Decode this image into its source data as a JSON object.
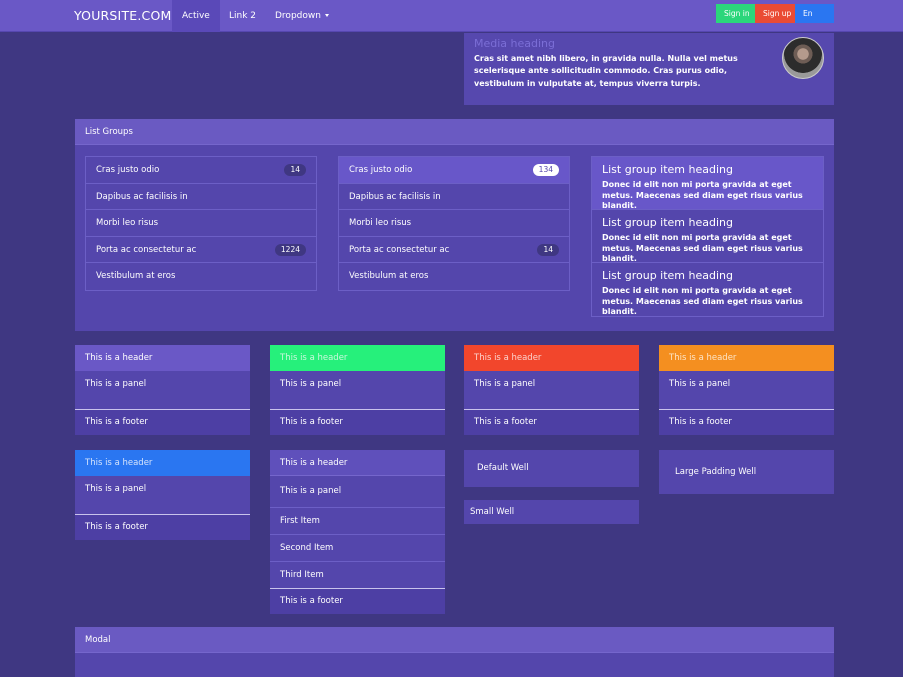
{
  "navbar": {
    "brand": "YOURSITE.COM",
    "links": [
      "Active",
      "Link 2",
      "Dropdown"
    ],
    "buttons": [
      {
        "label": "Sign in",
        "color": "#2bd67b"
      },
      {
        "label": "Sign up",
        "color": "#ea4b34"
      },
      {
        "label": "En",
        "color": "#2a76f1"
      }
    ],
    "background": "#6a58c6"
  },
  "media": {
    "heading": "Media heading",
    "text": "Cras sit amet nibh libero, in gravida nulla. Nulla vel metus scelerisque ante sollicitudin commodo. Cras purus odio, vestibulum in vulputate at, tempus viverra turpis.",
    "avatar_icon": "user-photo"
  },
  "list_groups": {
    "title": "List Groups",
    "list1": [
      {
        "label": "Cras justo odio",
        "badge": "14"
      },
      {
        "label": "Dapibus ac facilisis in",
        "badge": ""
      },
      {
        "label": "Morbi leo risus",
        "badge": ""
      },
      {
        "label": "Porta ac consectetur ac",
        "badge": "1224"
      },
      {
        "label": "Vestibulum at eros",
        "badge": ""
      }
    ],
    "list2": [
      {
        "label": "Cras justo odio",
        "badge": "134"
      },
      {
        "label": "Dapibus ac facilisis in",
        "badge": ""
      },
      {
        "label": "Morbi leo risus",
        "badge": ""
      },
      {
        "label": "Porta ac consectetur ac",
        "badge": "14"
      },
      {
        "label": "Vestibulum at eros",
        "badge": ""
      }
    ],
    "list3": [
      {
        "heading": "List group item heading",
        "text": "Donec id elit non mi porta gravida at eget metus. Maecenas sed diam eget risus varius blandit."
      },
      {
        "heading": "List group item heading",
        "text": "Donec id elit non mi porta gravida at eget metus. Maecenas sed diam eget risus varius blandit."
      },
      {
        "heading": "List group item heading",
        "text": "Donec id elit non mi porta gravida at eget metus. Maecenas sed diam eget risus varius blandit."
      }
    ]
  },
  "panels": [
    {
      "header": "This is a header",
      "body": "This is a panel",
      "footer": "This is a footer",
      "color": "#6a58c6"
    },
    {
      "header": "This is a header",
      "body": "This is a panel",
      "footer": "This is a footer",
      "color": "#26f07b"
    },
    {
      "header": "This is a header",
      "body": "This is a panel",
      "footer": "This is a footer",
      "color": "#f2462c"
    },
    {
      "header": "This is a header",
      "body": "This is a panel",
      "footer": "This is a footer",
      "color": "#f48f20"
    },
    {
      "header": "This is a header",
      "body": "This is a panel",
      "footer": "This is a footer",
      "color": "#2a76f1"
    },
    {
      "header": "This is a header",
      "body": "This is a panel",
      "footer": "This is a footer",
      "color": "#5446ac",
      "items": [
        "First Item",
        "Second Item",
        "Third Item"
      ]
    }
  ],
  "wells": {
    "default": "Default Well",
    "large": "Large Padding Well",
    "small": "Small Well"
  },
  "modal": {
    "title": "Modal"
  }
}
